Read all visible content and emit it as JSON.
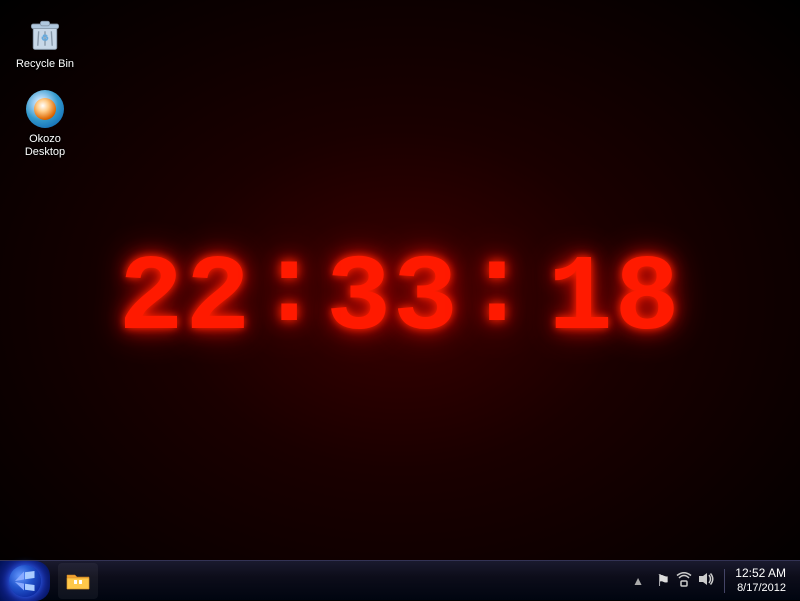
{
  "desktop": {
    "background": "dark red radial"
  },
  "icons": [
    {
      "id": "recycle-bin",
      "label": "Recycle Bin",
      "type": "recycle-bin"
    },
    {
      "id": "okozo-desktop",
      "label": "Okozo\nDesktop",
      "label_line1": "Okozo",
      "label_line2": "Desktop",
      "type": "okozo"
    }
  ],
  "clock": {
    "display": "22:33: 18",
    "hours": "22",
    "colon1": ":",
    "minutes": "33",
    "colon2": ":",
    "seconds": "18"
  },
  "taskbar": {
    "start_tooltip": "Start",
    "pinned_icons": [
      {
        "name": "windows-explorer",
        "label": "Windows Explorer"
      }
    ]
  },
  "system_tray": {
    "time": "12:52 AM",
    "date": "8/17/2012",
    "icons": [
      {
        "name": "up-arrow",
        "symbol": "▲"
      },
      {
        "name": "flag-icon",
        "symbol": "⚑"
      },
      {
        "name": "network-icon",
        "symbol": "⊞"
      },
      {
        "name": "speaker-icon",
        "symbol": "🔊"
      }
    ]
  }
}
